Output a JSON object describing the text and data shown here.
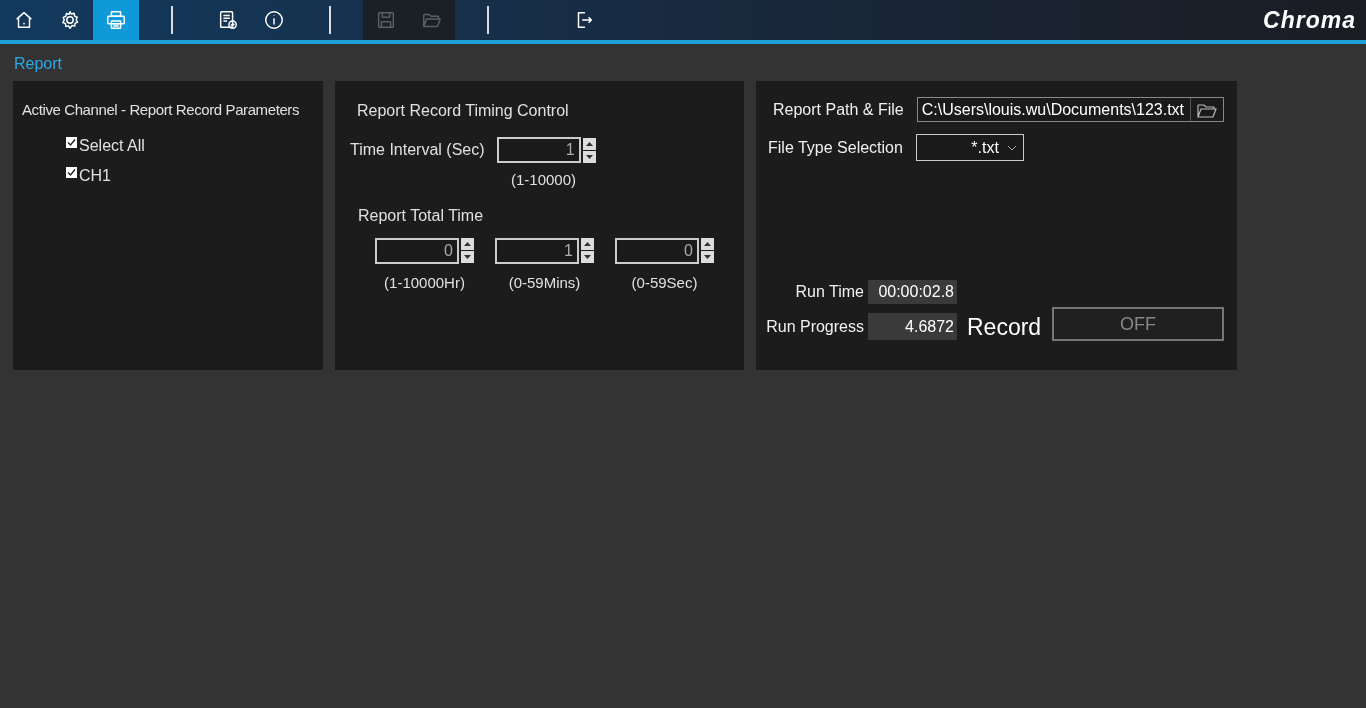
{
  "toolbar": {
    "groups": [
      [
        {
          "kind": "home",
          "selected": false,
          "disabled": false
        },
        {
          "kind": "settings",
          "selected": false,
          "disabled": false
        },
        {
          "kind": "print",
          "selected": true,
          "disabled": false
        }
      ],
      [
        {
          "kind": "report",
          "selected": false,
          "disabled": false
        },
        {
          "kind": "info",
          "selected": false,
          "disabled": false
        }
      ],
      [
        {
          "kind": "save",
          "selected": false,
          "disabled": true
        },
        {
          "kind": "open",
          "selected": false,
          "disabled": true
        }
      ],
      [
        {
          "kind": "exit",
          "selected": false,
          "disabled": false
        }
      ]
    ],
    "logo": "Chroma"
  },
  "breadcrumb": "Report",
  "channels_panel": {
    "title": "Active Channel - Report Record Parameters",
    "channels": [
      {
        "label": "Select All",
        "checked": true
      },
      {
        "label": "CH1",
        "checked": true
      }
    ]
  },
  "timing_panel": {
    "title": "Report Record Timing Control",
    "interval": {
      "label": "Time Interval (Sec)",
      "value": "1",
      "range": "(1-10000)"
    },
    "total_time": {
      "label": "Report Total Time",
      "fields": [
        {
          "value": "0",
          "range": "(1-10000Hr)"
        },
        {
          "value": "1",
          "range": "(0-59Mins)"
        },
        {
          "value": "0",
          "range": "(0-59Sec)"
        }
      ]
    }
  },
  "file_panel": {
    "path_label": "Report Path & File",
    "path": "C:\\Users\\louis.wu\\Documents\\123.txt",
    "type_label": "File Type Selection",
    "type_value": "*.txt",
    "run_time_label": "Run Time",
    "run_time": "00:00:02.8",
    "run_progress_label": "Run Progress",
    "run_progress": "4.6872",
    "record_label": "Record",
    "record_button": "OFF",
    "record_on": false
  }
}
